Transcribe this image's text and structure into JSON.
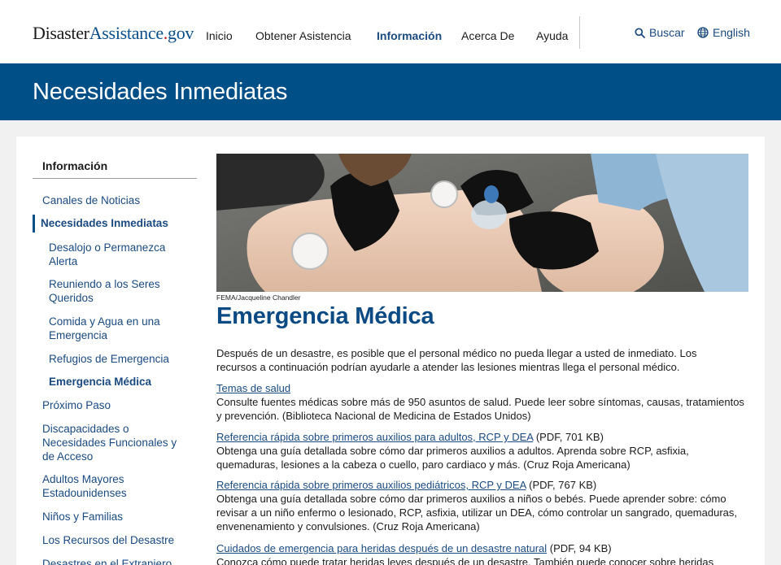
{
  "header": {
    "logo": {
      "part1": "Disaster",
      "part2": "Assistance",
      "dot": ".",
      "part3": "gov"
    },
    "nav": [
      {
        "label": "Inicio",
        "active": false
      },
      {
        "label": "Obtener Asistencia",
        "active": false
      },
      {
        "label": "Información",
        "active": true
      },
      {
        "label": "Acerca De",
        "active": false
      },
      {
        "label": "Ayuda",
        "active": false
      }
    ],
    "search_label": "Buscar",
    "language_label": "English"
  },
  "banner": {
    "title": "Necesidades Inmediatas"
  },
  "sidebar": {
    "heading": "Información",
    "items": [
      {
        "label": "Canales de Noticias"
      },
      {
        "label": "Necesidades Inmediatas"
      },
      {
        "label": "Desalojo o Permanezca Alerta"
      },
      {
        "label": "Reuniendo a los Seres Queridos"
      },
      {
        "label": "Comida y Agua en una Emergencia"
      },
      {
        "label": "Refugios de Emergencia"
      },
      {
        "label": "Emergencia Médica"
      },
      {
        "label": "Próximo Paso"
      },
      {
        "label": "Discapacidades o Necesidades Funcionales y de Acceso"
      },
      {
        "label": "Adultos Mayores Estadounidenses"
      },
      {
        "label": "Niños y Familias"
      },
      {
        "label": "Los Recursos del Desastre"
      },
      {
        "label": "Desastres en el Extranjero"
      }
    ]
  },
  "main": {
    "photo_credit": "FEMA/Jacqueline Chandler",
    "title": "Emergencia Médica",
    "intro": "Después de un desastre, es posible que el personal médico no pueda llegar a usted de inmediato. Los recursos a continuación podrían ayudarle a atender las lesiones mientras llega el personal médico.",
    "resources": [
      {
        "link": "Temas de salud",
        "meta": "",
        "desc": "Consulte fuentes médicas sobre más de 950 asuntos de salud. Puede leer sobre síntomas, causas, tratamientos y prevención. (Biblioteca Nacional de Medicina de Estados Unidos)"
      },
      {
        "link": "Referencia rápida sobre primeros auxilios para adultos, RCP y DEA",
        "meta": " (PDF, 701 KB)",
        "desc": "Obtenga una guía detallada sobre cómo dar primeros auxilios a adultos. Aprenda sobre RCP, asfixia, quemaduras, lesiones a la cabeza o cuello, paro cardiaco y más. (Cruz Roja Americana)"
      },
      {
        "link": "Referencia rápida sobre primeros auxilios pediátricos, RCP y DEA",
        "meta": " (PDF, 767 KB)",
        "desc": "Obtenga una guía detallada sobre cómo dar primeros auxilios a niños o bebés. Puede aprender sobre: cómo revisar a un niño enfermo o lesionado, RCP, asfixia, utilizar un DEA, cómo controlar un sangrado, quemaduras, envenenamiento y convulsiones. (Cruz Roja Americana)"
      },
      {
        "link": "Cuidados de emergencia para heridas después de un desastre natural",
        "meta": " (PDF, 94 KB)",
        "desc": "Conozca cómo puede tratar heridas leves después de un desastre. También puede conocer sobre heridas"
      }
    ]
  }
}
